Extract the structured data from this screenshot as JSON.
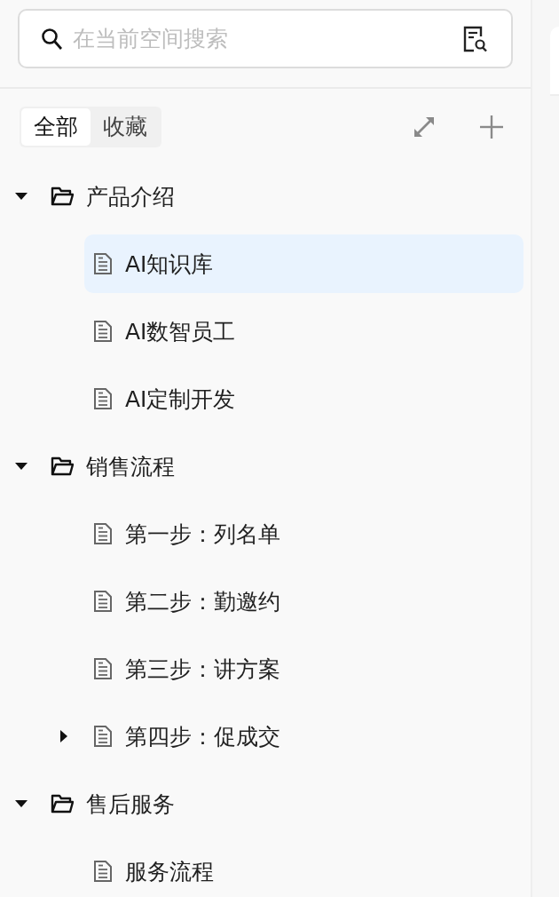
{
  "search": {
    "placeholder": "在当前空间搜索"
  },
  "tabs": [
    {
      "label": "全部",
      "selected": true
    },
    {
      "label": "收藏",
      "selected": false
    }
  ],
  "tree": [
    {
      "label": "产品介绍",
      "kind": "folder",
      "expanded": true,
      "selected": false,
      "children": [
        {
          "label": "AI知识库",
          "kind": "doc",
          "selected": true
        },
        {
          "label": "AI数智员工",
          "kind": "doc",
          "selected": false
        },
        {
          "label": "AI定制开发",
          "kind": "doc",
          "selected": false
        }
      ]
    },
    {
      "label": "销售流程",
      "kind": "folder",
      "expanded": true,
      "selected": false,
      "children": [
        {
          "label": "第一步：列名单",
          "kind": "doc",
          "selected": false
        },
        {
          "label": "第二步：勤邀约",
          "kind": "doc",
          "selected": false
        },
        {
          "label": "第三步：讲方案",
          "kind": "doc",
          "selected": false
        },
        {
          "label": "第四步：促成交",
          "kind": "doc",
          "expanded": false,
          "selected": false
        }
      ]
    },
    {
      "label": "售后服务",
      "kind": "folder",
      "expanded": true,
      "selected": false,
      "children": [
        {
          "label": "服务流程",
          "kind": "doc",
          "selected": false
        }
      ]
    }
  ]
}
